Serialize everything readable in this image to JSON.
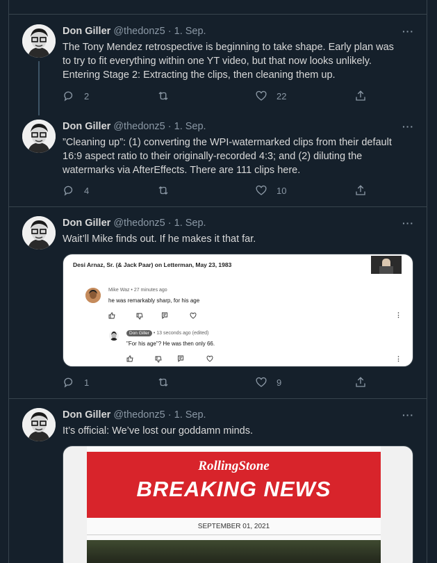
{
  "tweets": [
    {
      "name": "Don Giller",
      "handle": "@thedonz5",
      "dot": "·",
      "date": "1. Sep.",
      "text_lines": [
        "The Tony Mendez retrospective is beginning to take shape. Early plan was",
        "to try to fit everything within one YT video, but that now looks unlikely.",
        "Entering Stage 2: Extracting the clips, then cleaning them up."
      ],
      "replies": "2",
      "retweets": "",
      "likes": "22"
    },
    {
      "name": "Don Giller",
      "handle": "@thedonz5",
      "dot": "·",
      "date": "1. Sep.",
      "text_lines": [
        "”Cleaning up”: (1) converting the WPI-watermarked clips from their default",
        "16:9 aspect ratio to their originally-recorded 4:3; and (2) diluting the",
        "watermarks via AfterEffects. There are 111 clips here."
      ],
      "replies": "4",
      "retweets": "",
      "likes": "10"
    },
    {
      "name": "Don Giller",
      "handle": "@thedonz5",
      "dot": "·",
      "date": "1. Sep.",
      "text_lines": [
        "Wait’ll Mike finds out. If he makes it that far."
      ],
      "replies": "1",
      "retweets": "",
      "likes": "9",
      "media": {
        "video_title": "Desi Arnaz, Sr. (& Jack Paar) on Letterman, May 23, 1983",
        "comment1": {
          "author": "Mike Waz",
          "sep": "•",
          "time": "27 minutes ago",
          "text": "he was remarkably sharp, for his age"
        },
        "comment2": {
          "author": "Don Giller",
          "sep": "•",
          "time": "13 seconds ago (edited)",
          "text": "\"For his age\"? He was then only 66."
        }
      }
    },
    {
      "name": "Don Giller",
      "handle": "@thedonz5",
      "dot": "·",
      "date": "1. Sep.",
      "text_lines": [
        "It’s official: We’ve lost our goddamn minds."
      ],
      "media": {
        "logo": "RollingStone",
        "headline": "BREAKING NEWS",
        "date": "SEPTEMBER 01, 2021"
      }
    }
  ],
  "more_label": "···",
  "colors": {
    "background": "#15202b",
    "border": "#38444d",
    "muted": "#8b98a5",
    "rs_red": "#d8242b"
  }
}
